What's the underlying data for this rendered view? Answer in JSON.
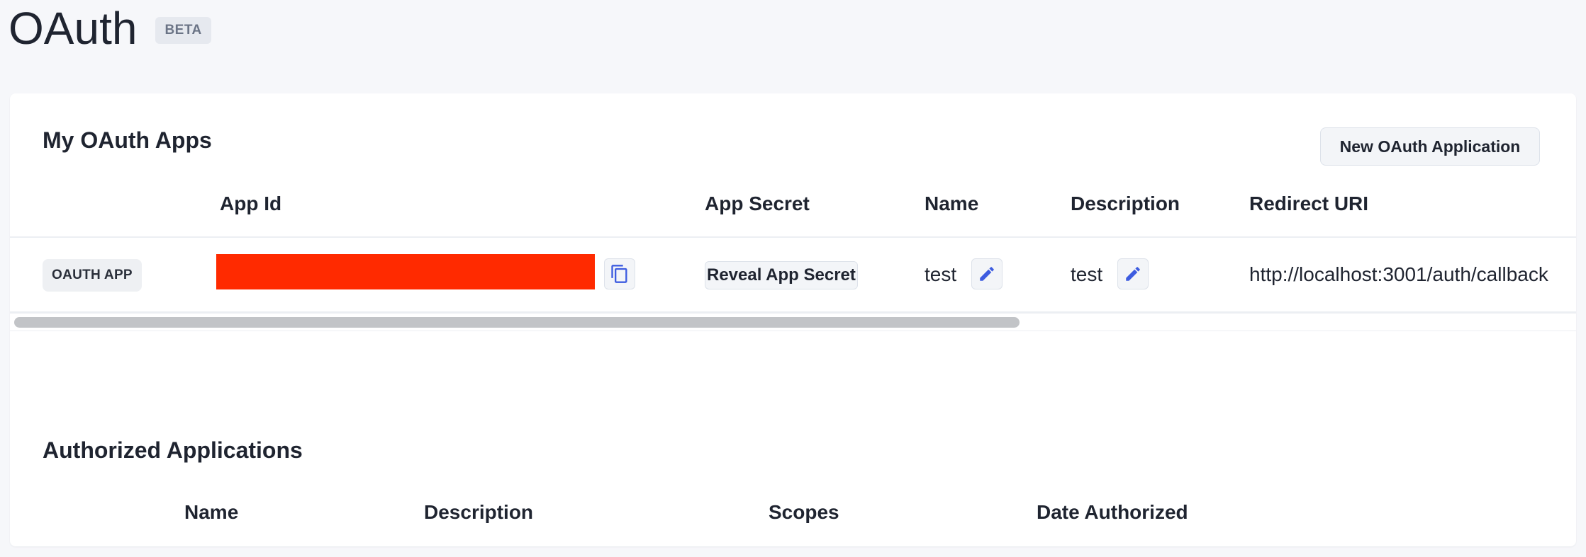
{
  "page": {
    "title": "OAuth",
    "badge": "BETA"
  },
  "my_apps": {
    "title": "My OAuth Apps",
    "new_button": "New OAuth Application",
    "columns": [
      "App Id",
      "App Secret",
      "Name",
      "Description",
      "Redirect URI"
    ],
    "rows": [
      {
        "type_badge": "OAUTH APP",
        "reveal_label": "Reveal App Secret",
        "name": "test",
        "description": "test",
        "redirect_uri": "http://localhost:3001/auth/callback"
      }
    ]
  },
  "authorized": {
    "title": "Authorized Applications",
    "columns": [
      "Name",
      "Description",
      "Scopes",
      "Date Authorized"
    ]
  },
  "colors": {
    "redaction": "#ff2a00",
    "icon_accent": "#3d5ce0"
  },
  "icons": {
    "copy": "copy-icon",
    "edit": "pencil-icon"
  },
  "scrollbar": {
    "thumb_fraction": 0.64
  }
}
